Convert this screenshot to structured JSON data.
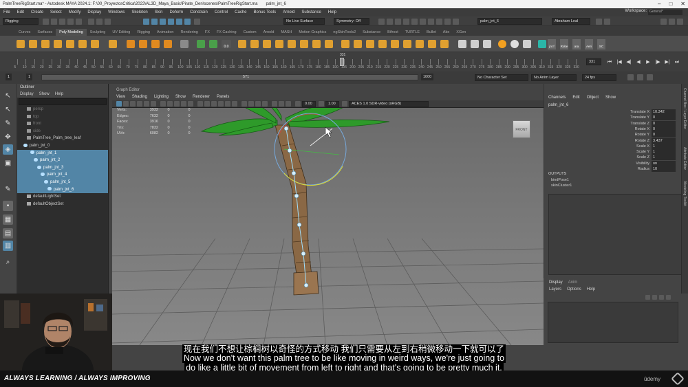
{
  "window": {
    "title": "PalmTreeRigStart.ma* - Autodesk MAYA 2024.1: F:\\00_ProyectosCritica\\2023\\AL3D_Maya_Basic\\Pirate_Den\\scenes\\PalmTreeRigStart.ma",
    "selected_object": "palm_jnt_6"
  },
  "menubar": {
    "items": [
      "File",
      "Edit",
      "Create",
      "Select",
      "Modify",
      "Display",
      "Windows",
      "Skeleton",
      "Skin",
      "Deform",
      "Constrain",
      "Control",
      "Cache",
      "Bonus Tools",
      "Arnold",
      "Substance",
      "Help"
    ],
    "workspace_label": "Workspace:",
    "workspace_value": "General*"
  },
  "statusline": {
    "menuset": "Rigging",
    "live_surface": "No Live Surface",
    "symmetry": "Symmetry: Off",
    "object_field": "palm_jnt_6",
    "user": "Abraham Leal"
  },
  "shelf": {
    "tabs": [
      "Curves",
      "Surfaces",
      "Poly Modeling",
      "Sculpting",
      "UV Editing",
      "Rigging",
      "Animation",
      "Rendering",
      "FX",
      "FX Caching",
      "Custom",
      "Arnold",
      "MASH",
      "Motion Graphics",
      "ngSkinTools2",
      "Substance",
      "Bifrost",
      "TURTLE",
      "Bullet",
      "Abx",
      "XGen"
    ],
    "active_tab": "Poly Modeling",
    "labeled_buttons": [
      "jnt f",
      "Robe",
      "ara",
      "Aeri",
      "SC"
    ],
    "readout": "0.0"
  },
  "timeline": {
    "ticks": [
      "5",
      "10",
      "15",
      "20",
      "25",
      "30",
      "35",
      "40",
      "45",
      "50",
      "55",
      "60",
      "65",
      "70",
      "75",
      "80",
      "85",
      "90",
      "95",
      "100",
      "105",
      "110",
      "115",
      "120",
      "125",
      "130",
      "135",
      "140",
      "145",
      "150",
      "155",
      "160",
      "165",
      "170",
      "175",
      "180",
      "185",
      "190",
      "195",
      "200",
      "205",
      "210",
      "215",
      "220",
      "225",
      "230",
      "235",
      "240",
      "245",
      "250",
      "255",
      "260",
      "265",
      "270",
      "275",
      "280",
      "285",
      "290",
      "295",
      "300",
      "305",
      "310",
      "315",
      "320",
      "325",
      "330"
    ],
    "current_frame_marker": "331",
    "current_frame": "331"
  },
  "rangebar": {
    "start": "1",
    "start_inner": "1",
    "range_end": "571",
    "end": "1000",
    "character_set": "No Character Set",
    "anim_layer": "No Anim Layer",
    "fps": "24 fps"
  },
  "outliner": {
    "title": "Outliner",
    "menu": [
      "Display",
      "Show",
      "Help"
    ],
    "items": [
      {
        "label": "persp",
        "indent": 2,
        "selected": false,
        "dim": true
      },
      {
        "label": "top",
        "indent": 2,
        "selected": false,
        "dim": true
      },
      {
        "label": "front",
        "indent": 2,
        "selected": false,
        "dim": true
      },
      {
        "label": "side",
        "indent": 2,
        "selected": false,
        "dim": true
      },
      {
        "label": "PalmTree_Palm_tree_leaf",
        "indent": 2,
        "selected": false,
        "dim": false
      },
      {
        "label": "palm_jnt_0",
        "indent": 1,
        "selected": false,
        "dim": false
      },
      {
        "label": "palm_jnt_1",
        "indent": 3,
        "selected": true,
        "dim": false
      },
      {
        "label": "palm_jnt_2",
        "indent": 4,
        "selected": true,
        "dim": false
      },
      {
        "label": "palm_jnt_3",
        "indent": 5,
        "selected": true,
        "dim": false
      },
      {
        "label": "palm_jnt_4",
        "indent": 6,
        "selected": true,
        "dim": false
      },
      {
        "label": "palm_jnt_5",
        "indent": 7,
        "selected": true,
        "dim": false
      },
      {
        "label": "palm_jnt_6",
        "indent": 8,
        "selected": true,
        "dim": false
      },
      {
        "label": "defaultLightSet",
        "indent": 2,
        "selected": false,
        "dim": false
      },
      {
        "label": "defaultObjectSet",
        "indent": 2,
        "selected": false,
        "dim": false
      }
    ]
  },
  "viewport": {
    "panel_title": "Graph Editor",
    "menu": [
      "View",
      "Shading",
      "Lighting",
      "Show",
      "Renderer",
      "Panels"
    ],
    "exposure": "0.00",
    "gamma": "1.00",
    "color_space": "ACES 1.0 SDR-video (sRGB)",
    "view_cube_label": "FRONT",
    "hud": [
      {
        "label": "Verts:",
        "a": "3932",
        "b": "0",
        "c": "0"
      },
      {
        "label": "Edges:",
        "a": "7632",
        "b": "0",
        "c": "0"
      },
      {
        "label": "Faces:",
        "a": "3916",
        "b": "0",
        "c": "0"
      },
      {
        "label": "Tris:",
        "a": "7832",
        "b": "0",
        "c": "0"
      },
      {
        "label": "UVs:",
        "a": "6082",
        "b": "0",
        "c": "0"
      }
    ],
    "fps_readout": "fps"
  },
  "channel_box": {
    "menu": [
      "Channels",
      "Edit",
      "Object",
      "Show"
    ],
    "node_name": "palm_jnt_6",
    "attributes": [
      {
        "name": "Translate X",
        "value": "10.342"
      },
      {
        "name": "Translate Y",
        "value": "0"
      },
      {
        "name": "Translate Z",
        "value": "0"
      },
      {
        "name": "Rotate X",
        "value": "0"
      },
      {
        "name": "Rotate Y",
        "value": "0"
      },
      {
        "name": "Rotate Z",
        "value": "3.437"
      },
      {
        "name": "Scale X",
        "value": "1"
      },
      {
        "name": "Scale Y",
        "value": "1"
      },
      {
        "name": "Scale Z",
        "value": "1"
      },
      {
        "name": "Visibility",
        "value": "on"
      },
      {
        "name": "Radius",
        "value": "10"
      }
    ],
    "outputs_label": "OUTPUTS",
    "outputs": [
      "bindPose1",
      "skinCluster1"
    ]
  },
  "layers": {
    "tabs": [
      "Display",
      "Anim"
    ],
    "menu": [
      "Layers",
      "Options",
      "Help"
    ]
  },
  "side_tabs": [
    "Channel Box / Layer Editor",
    "Attribute Editor",
    "Modeling Toolkit"
  ],
  "overlay": {
    "subtitle_zh": "现在我们不想让棕榈树以奇怪的方式移动 我们只需要从左到右稍微移动一下就可以了",
    "subtitle_en_1": "Now we don't want this palm tree to be like moving in weird ways, we're just going to",
    "subtitle_en_2": "do like a little bit of movement from left to right and that's going to be pretty much it,",
    "brand": "ALWAYS LEARNING / ALWAYS IMPROVING",
    "logo": "ûdemy"
  },
  "colors": {
    "selection": "#5285a6",
    "leaf_green": "#2e9a2a",
    "trunk_brown": "#8a6845",
    "joint_cyan": "#9fe0ff"
  }
}
